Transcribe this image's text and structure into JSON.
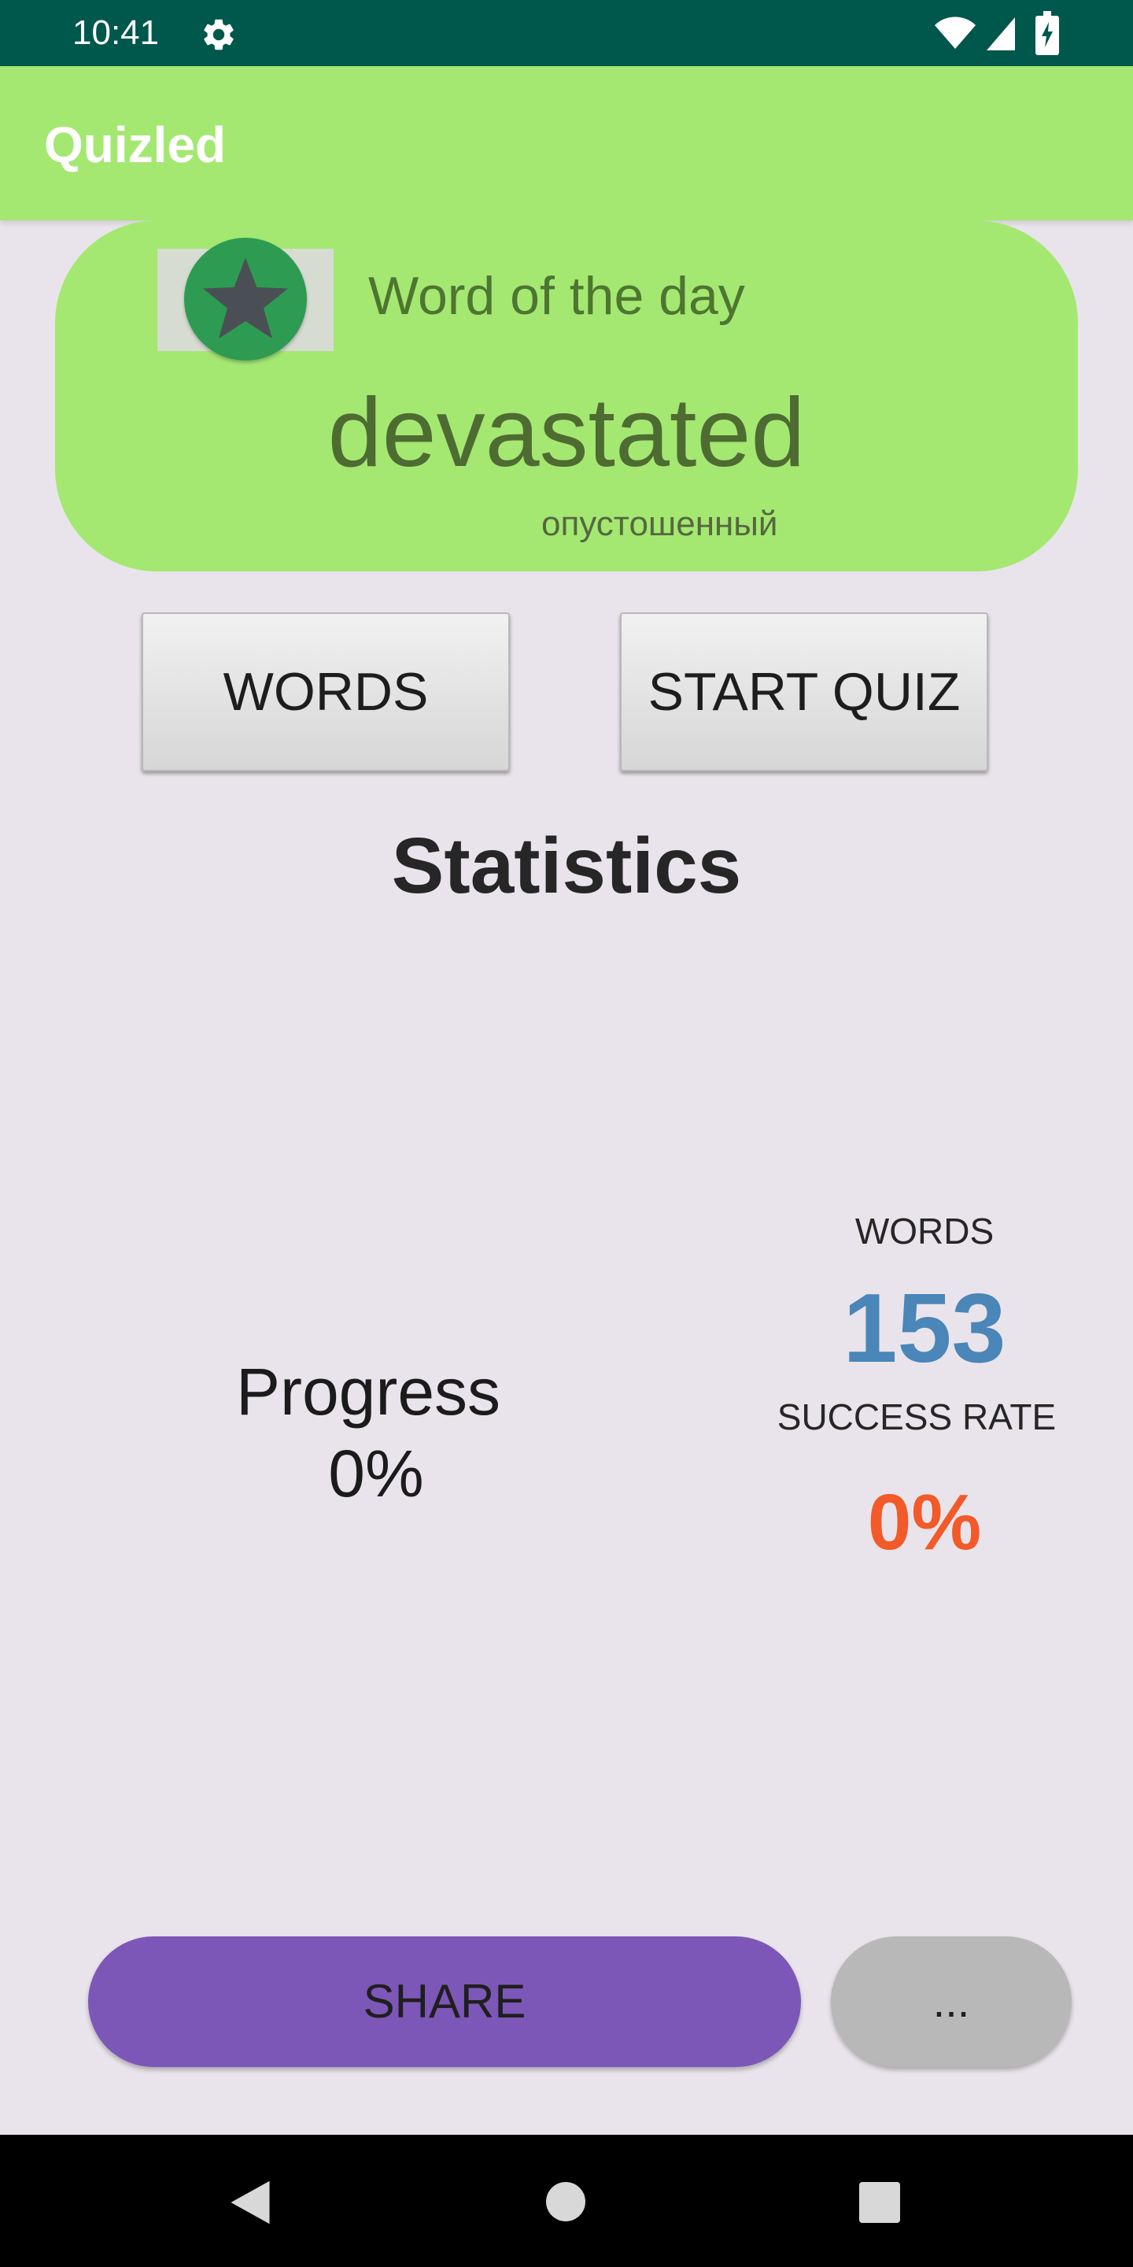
{
  "status_bar": {
    "time": "10:41",
    "icons": [
      "gear-icon",
      "wifi-icon",
      "signal-icon",
      "battery-icon"
    ]
  },
  "app_bar": {
    "title": "Quizled"
  },
  "word_of_day": {
    "label": "Word of the day",
    "word": "devastated",
    "translation": "опустошенный",
    "icon": "star-icon"
  },
  "buttons": {
    "words": "WORDS",
    "start_quiz": "START QUIZ",
    "share": "SHARE",
    "more": "..."
  },
  "statistics": {
    "title": "Statistics",
    "progress_label": "Progress",
    "progress_value": "0%",
    "words_label": "WORDS",
    "words_value": "153",
    "success_rate_label": "SUCCESS RATE",
    "success_rate_value": "0%"
  },
  "nav_bar": {
    "icons": [
      "back-icon",
      "home-icon",
      "recents-icon"
    ]
  },
  "colors": {
    "status_bar": "#00574b",
    "app_bar": "#a4e872",
    "share": "#7c57b8",
    "words_count": "#4a86b8",
    "success_rate": "#f25a29"
  }
}
